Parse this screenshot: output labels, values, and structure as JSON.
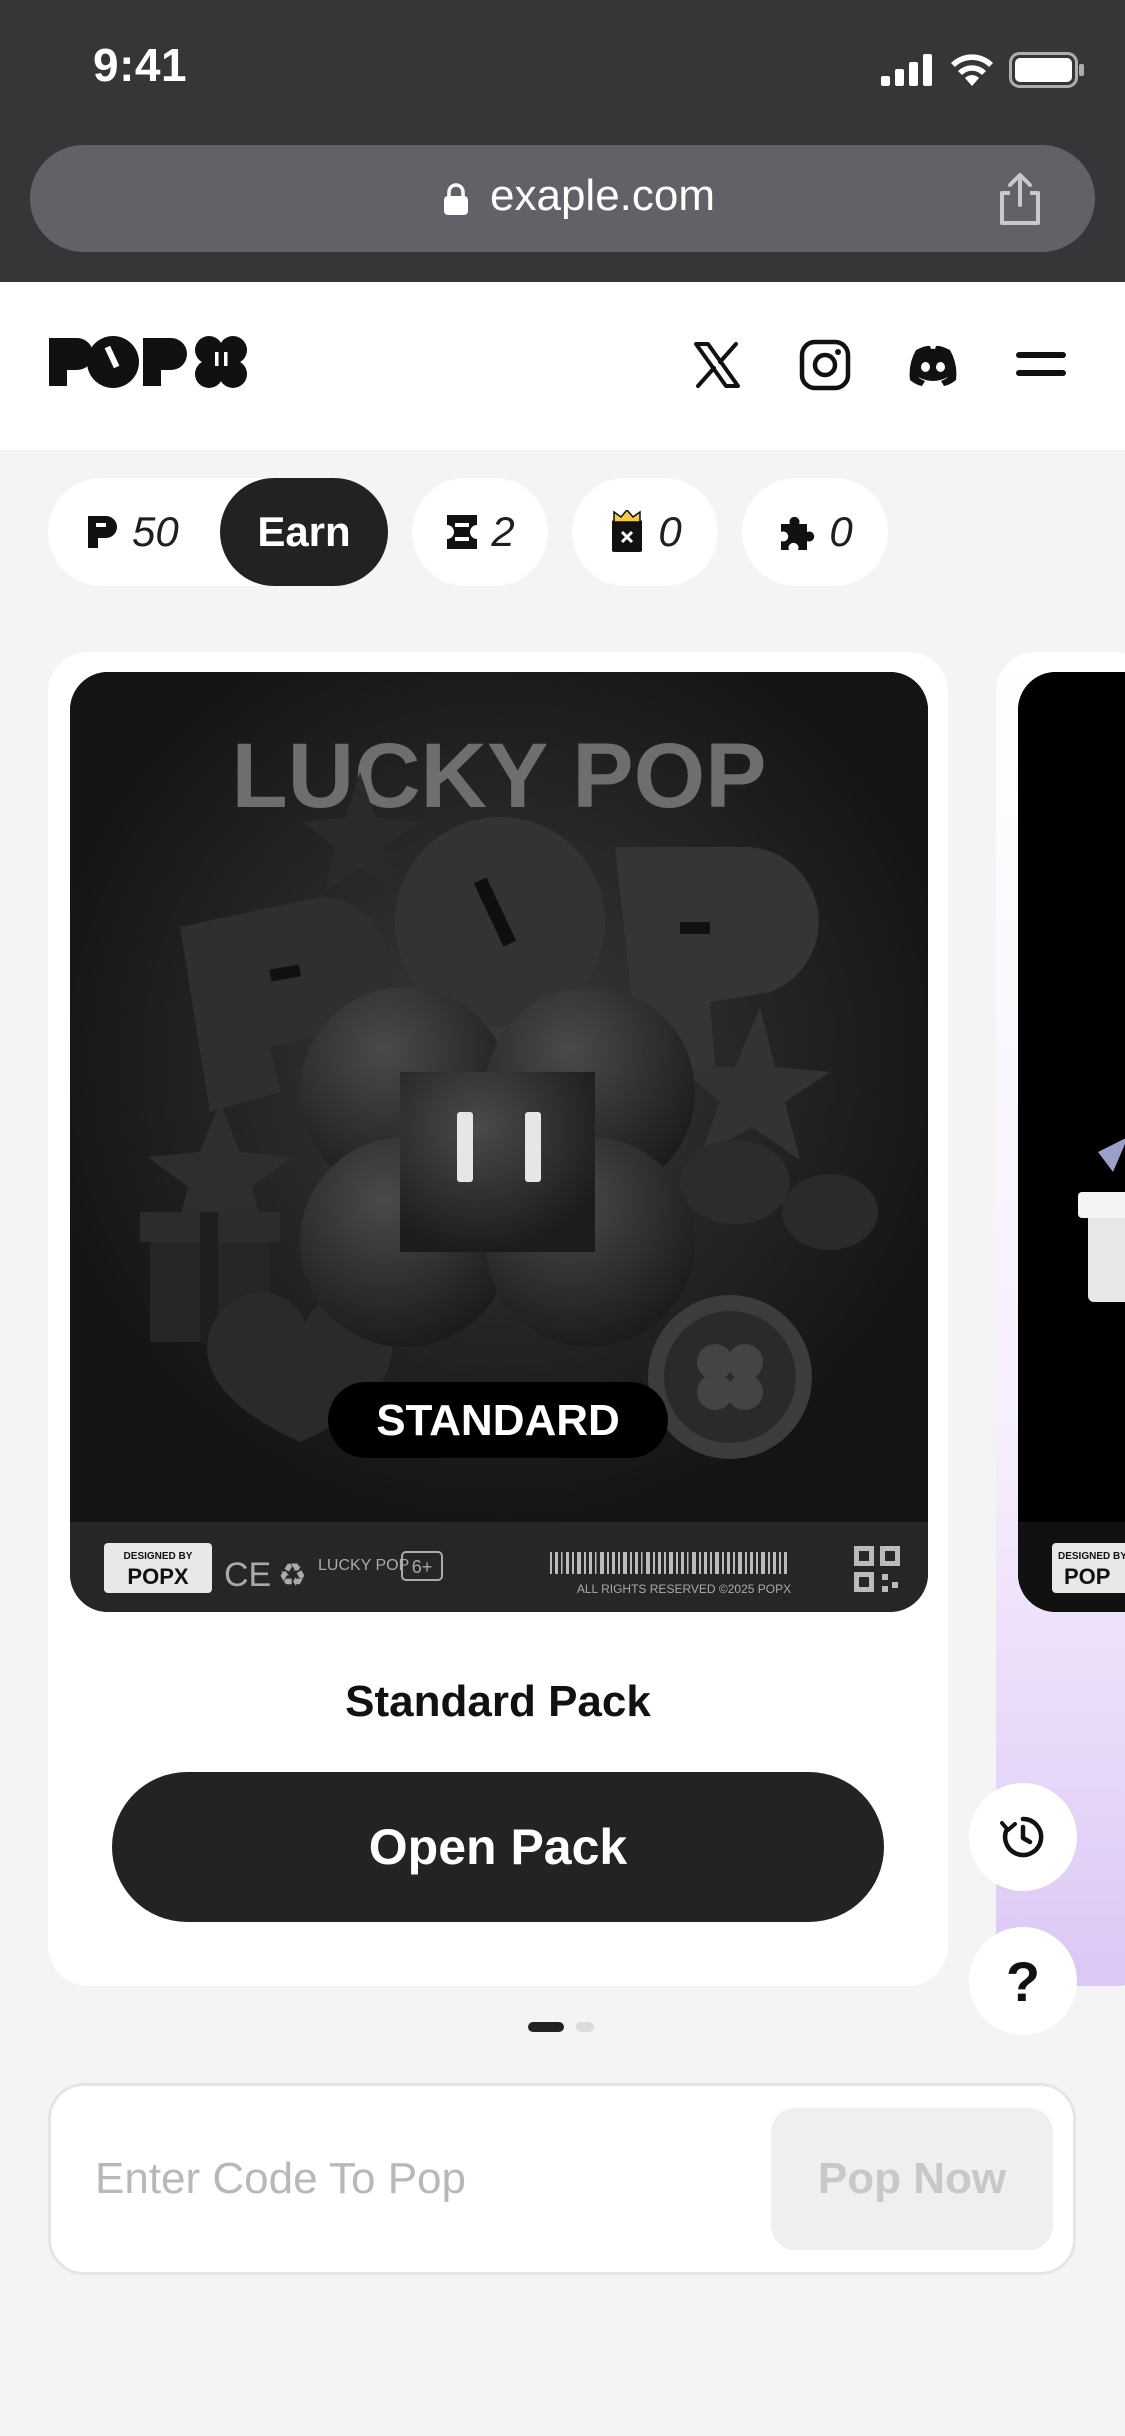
{
  "status_bar": {
    "time": "9:41"
  },
  "browser": {
    "url": "exaple.com"
  },
  "header": {
    "logo_icon": "popx-logo",
    "x_icon": "x-icon",
    "instagram_icon": "instagram-icon",
    "discord_icon": "discord-icon",
    "menu_icon": "menu-icon"
  },
  "chips": {
    "points": "50",
    "earn_label": "Earn",
    "tickets": "2",
    "crowns": "0",
    "puzzles": "0"
  },
  "card": {
    "art_title": "LUCKY POP",
    "art_badge": "STANDARD",
    "designed_by": "DESIGNED BY",
    "brand_mark": "POPX",
    "lucky_pop_small": "LUCKY POP",
    "age_rating": "6+",
    "rights": "ALL RIGHTS RESERVED ©2025 POPX",
    "pack_name": "Standard Pack",
    "open_label": "Open Pack"
  },
  "peek_card": {
    "designed_by": "DESIGNED BY",
    "brand_mark": "POP"
  },
  "carousel": {
    "active_index": 0,
    "count": 2
  },
  "code_entry": {
    "placeholder": "Enter Code To Pop",
    "button_label": "Pop Now"
  },
  "floating": {
    "history_icon": "history-icon",
    "help_label": "?"
  },
  "colors": {
    "accent_dark": "#232323",
    "chrome": "#353638",
    "background": "#f4f4f4"
  }
}
